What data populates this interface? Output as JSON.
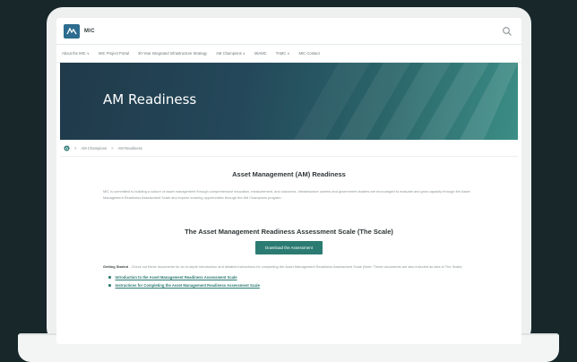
{
  "site": {
    "logo_text": "MIC"
  },
  "nav": {
    "items": [
      "About the MIC ∨",
      "MIC Project Portal",
      "30-Year Integrated Infrastructure Strategy",
      "AM Champions ∨",
      "MiAMC",
      "TAMC ∨",
      "MIC Contact"
    ]
  },
  "hero": {
    "title": "AM Readiness"
  },
  "breadcrumb": {
    "items": [
      "AM Champions",
      "AM Readiness"
    ],
    "separator": ">"
  },
  "main": {
    "heading": "Asset Management (AM) Readiness",
    "intro": "MIC is committed to building a culture of asset management through comprehensive education, measurement, and outcomes. Infrastructure owners and government leaders are encouraged to evaluate and grow capacity through the Asset Management Readiness Assessment Scale and explore learning opportunities through the AM Champions program.",
    "scale_heading": "The Asset Management Readiness Assessment Scale (The Scale)",
    "download_button": "Download the Assessment",
    "getting_started_label": "Getting Started",
    "getting_started_text": " - Check out these documents for an in-depth introduction and detailed instructions for completing the Asset Management Readiness Assessment Scale (Note: These documents are also included as tabs in The Scale).",
    "links": [
      "Introduction to the Asset Management Readiness Assessment Scale",
      "Instructions for Completing the Asset Management Readiness Assessment Scale"
    ]
  },
  "colors": {
    "accent": "#2c7b73",
    "page_bg": "#17272a",
    "logo": "#2d6c8f"
  },
  "icons": {
    "search": "search-icon",
    "home": "home-icon",
    "logo": "logo-icon"
  }
}
